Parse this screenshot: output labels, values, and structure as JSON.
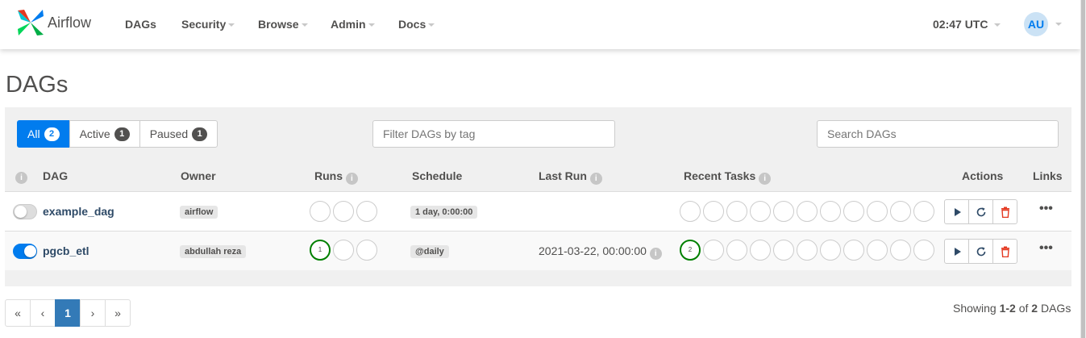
{
  "nav": {
    "brand": "Airflow",
    "items": [
      "DAGs",
      "Security",
      "Browse",
      "Admin",
      "Docs"
    ],
    "time": "02:47 UTC",
    "avatar": "AU"
  },
  "page_title": "DAGs",
  "filters": {
    "all_label": "All",
    "all_count": "2",
    "active_label": "Active",
    "active_count": "1",
    "paused_label": "Paused",
    "paused_count": "1",
    "tag_placeholder": "Filter DAGs by tag",
    "search_placeholder": "Search DAGs"
  },
  "table": {
    "headers": {
      "info": "i",
      "dag": "DAG",
      "owner": "Owner",
      "runs": "Runs",
      "schedule": "Schedule",
      "last_run": "Last Run",
      "recent_tasks": "Recent Tasks",
      "actions": "Actions",
      "links": "Links"
    },
    "rows": [
      {
        "name": "example_dag",
        "paused": true,
        "owner": "airflow",
        "schedule": "1 day, 0:00:00",
        "last_run": "",
        "runs_success": "",
        "tasks_success": ""
      },
      {
        "name": "pgcb_etl",
        "paused": false,
        "owner": "abdullah reza",
        "schedule": "@daily",
        "last_run": "2021-03-22, 00:00:00",
        "runs_success": "1",
        "tasks_success": "2"
      }
    ],
    "links_label": "•••"
  },
  "pagination": {
    "first": "«",
    "prev": "‹",
    "current": "1",
    "next": "›",
    "last": "»"
  },
  "showing": {
    "prefix": "Showing ",
    "range": "1-2",
    "of": " of ",
    "total": "2",
    "suffix": " DAGs"
  },
  "colors": {
    "accent": "#017cee",
    "success": "#008000",
    "delete": "#e43921",
    "dag_link": "#2e4a67"
  }
}
